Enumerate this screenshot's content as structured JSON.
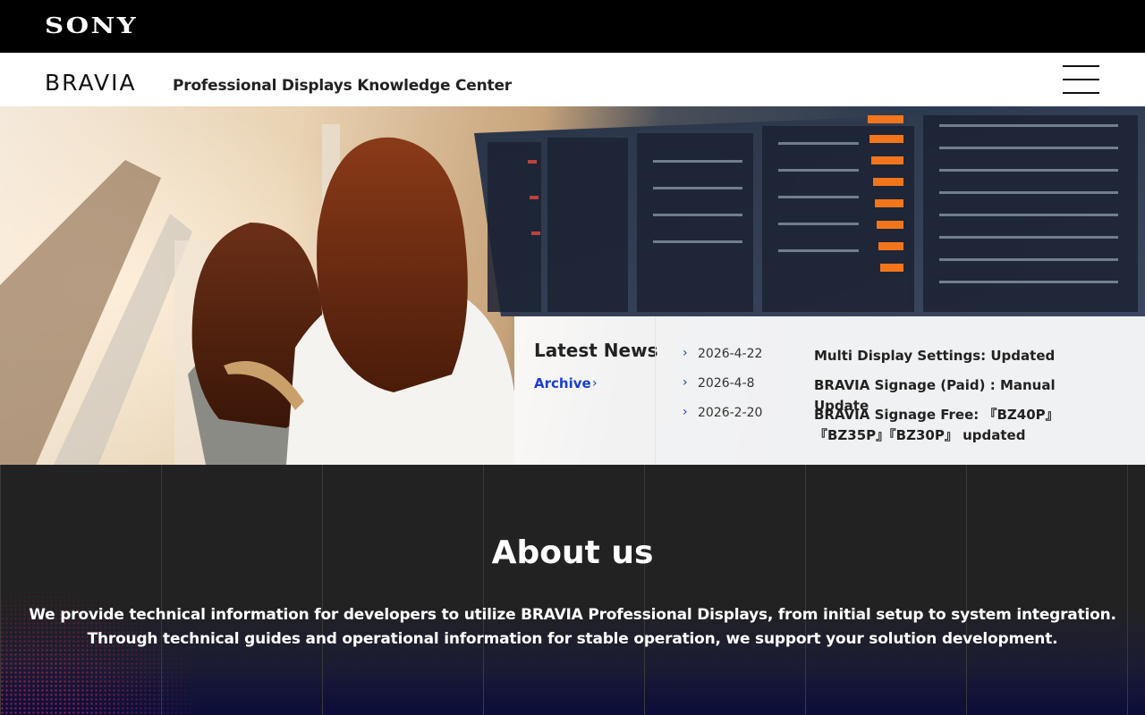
{
  "brand": {
    "sony": "SONY",
    "bravia": "BRAVIA"
  },
  "header": {
    "site_title": "Professional Displays Knowledge Center"
  },
  "news": {
    "heading": "Latest News",
    "archive_label": "Archive",
    "items": [
      {
        "date": "2026-4-22",
        "title": "Multi Display Settings: Updated"
      },
      {
        "date": "2026-4-8",
        "title": "BRAVIA Signage (Paid) : Manual Update"
      },
      {
        "date": "2026-2-20",
        "title": "BRAVIA Signage Free: 『BZ40P』『BZ35P』『BZ30P』 updated"
      }
    ]
  },
  "about": {
    "title": "About us",
    "line1": "We provide technical information for developers to utilize BRAVIA Professional Displays, from initial setup to system integration.",
    "line2": "Through technical guides and operational information for stable operation, we support your solution development."
  },
  "colors": {
    "link_blue": "#1a3fd0",
    "about_bg": "#222222",
    "accent_orange": "#ff7a1a"
  }
}
